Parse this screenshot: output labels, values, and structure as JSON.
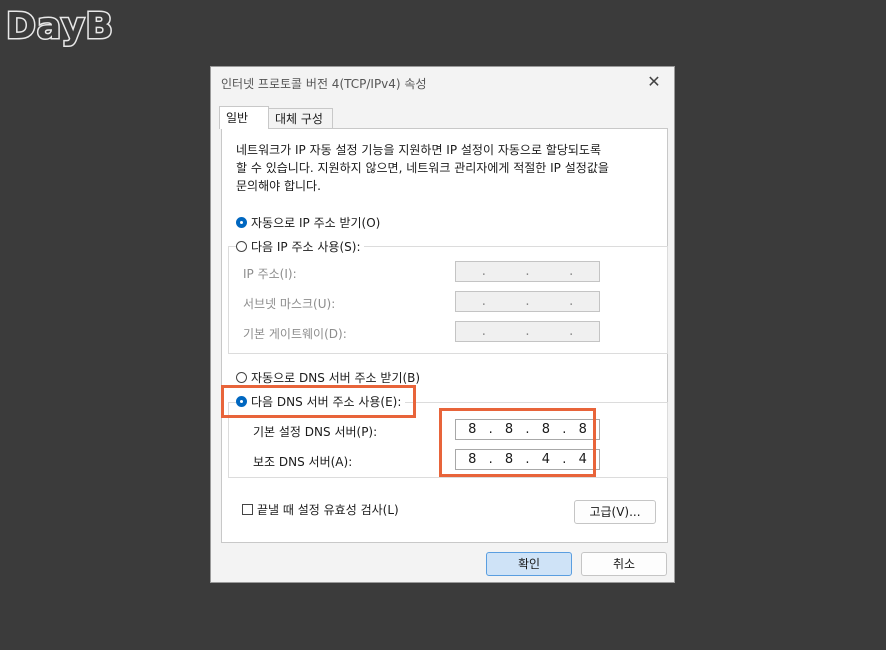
{
  "logo": "DayB",
  "dialog": {
    "title": "인터넷 프로토콜 버전 4(TCP/IPv4) 속성",
    "close": "✕"
  },
  "tabs": [
    {
      "label": "일반"
    },
    {
      "label": "대체 구성"
    }
  ],
  "description": [
    "네트워크가 IP 자동 설정 기능을 지원하면 IP 설정이 자동으로 할당되도록",
    "할 수 있습니다. 지원하지 않으면, 네트워크 관리자에게 적절한 IP 설정값을",
    "문의해야 합니다."
  ],
  "ip": {
    "auto_label": "자동으로 IP 주소 받기(O)",
    "manual_label": "다음 IP 주소 사용(S):",
    "auto_selected": true,
    "fields": [
      {
        "label": "IP 주소(I):",
        "value": [
          "",
          "",
          "",
          ""
        ]
      },
      {
        "label": "서브넷 마스크(U):",
        "value": [
          "",
          "",
          "",
          ""
        ]
      },
      {
        "label": "기본 게이트웨이(D):",
        "value": [
          "",
          "",
          "",
          ""
        ]
      }
    ]
  },
  "dns": {
    "auto_label": "자동으로 DNS 서버 주소 받기(B)",
    "manual_label": "다음 DNS 서버 주소 사용(E):",
    "manual_selected": true,
    "preferred_label": "기본 설정 DNS 서버(P):",
    "preferred": [
      "8",
      "8",
      "8",
      "8"
    ],
    "alternate_label": "보조 DNS 서버(A):",
    "alternate": [
      "8",
      "8",
      "4",
      "4"
    ]
  },
  "validate_label": "끝낼 때 설정 유효성 검사(L)",
  "buttons": {
    "advanced": "고급(V)...",
    "ok": "확인",
    "cancel": "취소"
  },
  "colors": {
    "highlight": "#e8643a",
    "accent": "#0067c0"
  }
}
